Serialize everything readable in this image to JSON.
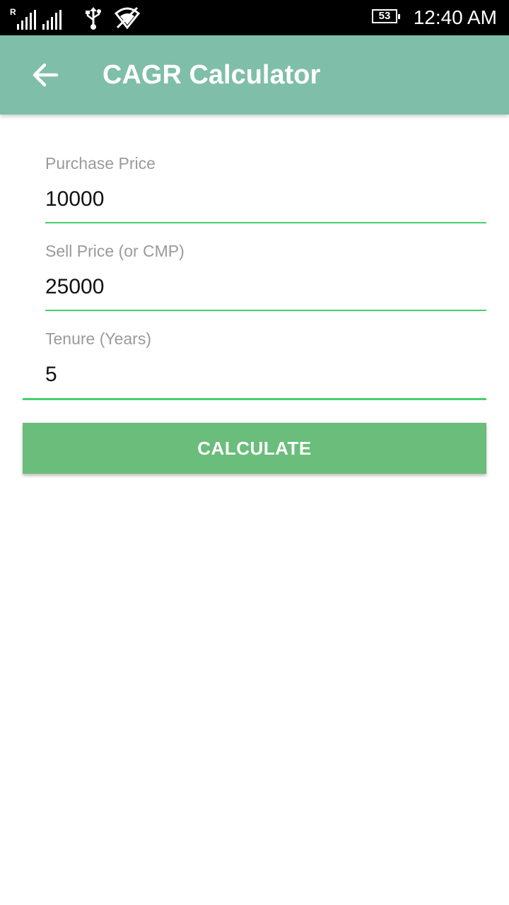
{
  "status_bar": {
    "network_letter": "R",
    "battery": "53",
    "time": "12:40 AM",
    "icons": [
      "signal-icon",
      "usb-icon",
      "wifi-off-icon",
      "battery-icon"
    ]
  },
  "app_bar": {
    "title": "CAGR Calculator",
    "back_icon": "arrow-left-icon",
    "color": "#7fbea9"
  },
  "form": {
    "purchase_price": {
      "label": "Purchase Price",
      "value": "10000"
    },
    "sell_price": {
      "label": "Sell Price (or CMP)",
      "value": "25000"
    },
    "tenure": {
      "label": "Tenure (Years)",
      "value": "5"
    },
    "accent_color": "#45d06b"
  },
  "calculate_button": {
    "label": "CALCULATE",
    "color": "#6abd7a"
  }
}
